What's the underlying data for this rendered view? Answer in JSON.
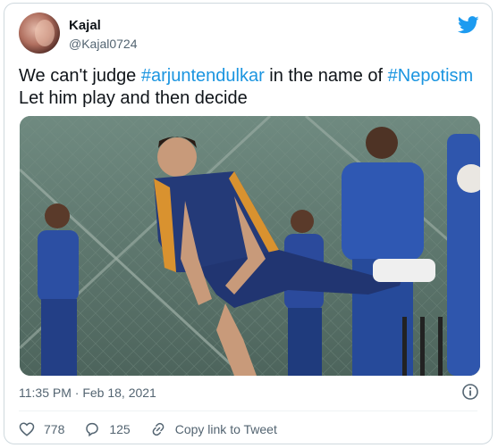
{
  "author": {
    "name": "Kajal",
    "handle": "@Kajal0724"
  },
  "tweet": {
    "text_1": "We can't judge ",
    "hashtag_1": "#arjuntendulkar",
    "text_2": " in the name of ",
    "hashtag_2": "#Nepotism",
    "line_2": "Let him play and then decide"
  },
  "timestamp": "11:35 PM · Feb 18, 2021",
  "actions": {
    "likes": "778",
    "replies": "125",
    "copy_link": "Copy link to Tweet"
  },
  "icons": {
    "brand": "twitter-bird-icon",
    "info": "info-icon",
    "like": "heart-icon",
    "reply": "reply-icon",
    "link": "link-icon"
  },
  "colors": {
    "brand": "#1d9bf0",
    "hashtag": "#1b95e0",
    "muted": "#536471",
    "jersey": "#1f3f8f"
  }
}
